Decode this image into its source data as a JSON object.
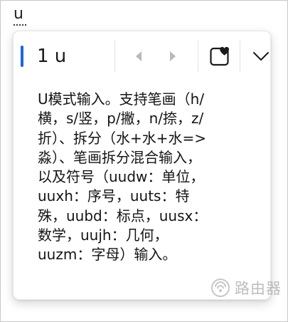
{
  "input": {
    "typed_text": "u"
  },
  "ime": {
    "composition_text": "1 u",
    "hint": "U模式输入。支持笔画（h/\n横，s/竖，p/撇，n/捺，z/\n折）、拆分（水+水+水=>\n淼）、笔画拆分混合输入，\n以及符号（uudw：单位，\nuuxh：序号，uuts：特\n殊，uubd：标点，uusx：\n数学，uujh：几何，\nuuzm：字母）输入。"
  },
  "icons": {
    "prev": "chevron-left-icon",
    "next": "chevron-right-icon",
    "favorite": "favorite-heart-icon",
    "expand": "chevron-down-icon"
  },
  "colors": {
    "caret": "#1a66e0",
    "paging_disabled": "#b9b9b9"
  },
  "watermark": {
    "label": "路由器"
  }
}
